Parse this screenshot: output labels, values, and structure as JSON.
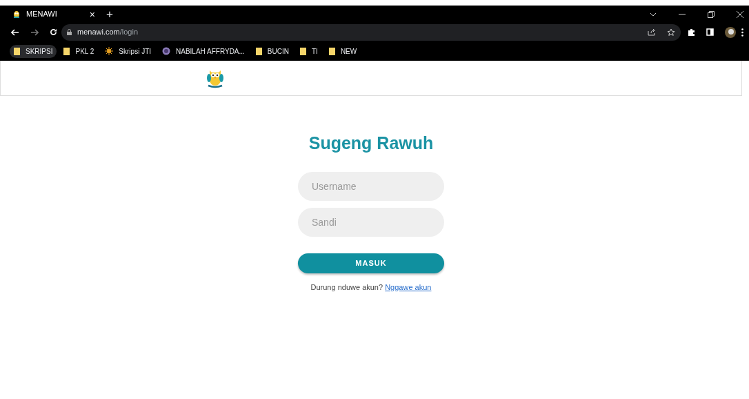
{
  "browser": {
    "tab": {
      "title": "MENAWI",
      "close": "×"
    },
    "new_tab": "+",
    "address": {
      "host": "menawi.com",
      "path": "/login"
    },
    "bookmarks": [
      {
        "label": "SKRIPSI",
        "kind": "folder",
        "selected": true
      },
      {
        "label": "PKL 2",
        "kind": "folder",
        "selected": false
      },
      {
        "label": "Skripsi JTI",
        "kind": "sun",
        "selected": false
      },
      {
        "label": "NABILAH AFFRYDA...",
        "kind": "seal",
        "selected": false
      },
      {
        "label": "BUCIN",
        "kind": "folder",
        "selected": false
      },
      {
        "label": "TI",
        "kind": "folder",
        "selected": false
      },
      {
        "label": "NEW",
        "kind": "folder",
        "selected": false
      }
    ]
  },
  "login": {
    "title": "Sugeng Rawuh",
    "fields": [
      {
        "placeholder": "Username"
      },
      {
        "placeholder": "Sandi"
      }
    ],
    "submit": "MASUK",
    "prompt": "Durung nduwe akun?",
    "signup_link": "Nggawe akun"
  }
}
